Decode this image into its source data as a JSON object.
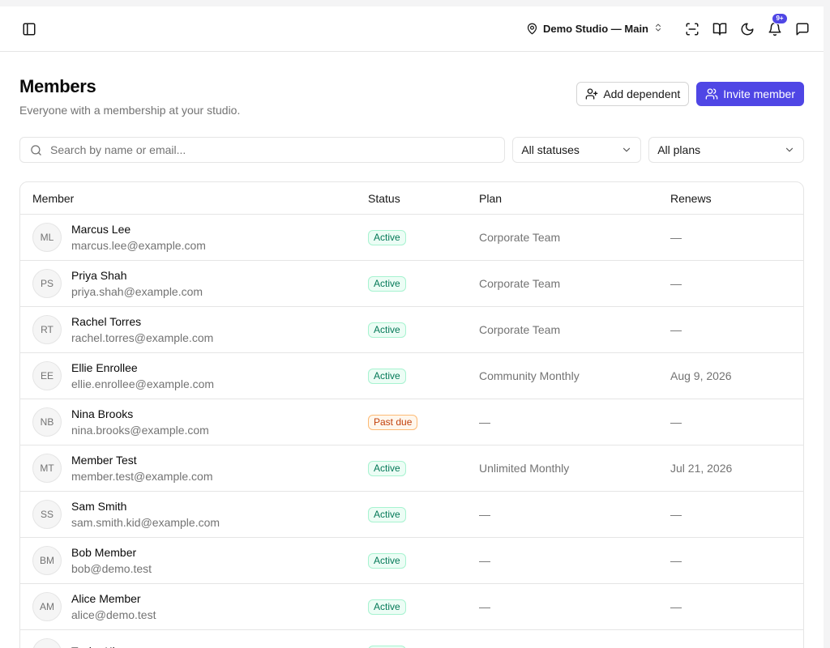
{
  "topbar": {
    "sidebar_toggle_icon": "panel-left-icon",
    "studio_name": "Demo Studio — Main",
    "notifications_count": "9+"
  },
  "page": {
    "title": "Members",
    "subtitle": "Everyone with a membership at your studio."
  },
  "actions": {
    "add_dependent": "Add dependent",
    "invite_member": "Invite member"
  },
  "filters": {
    "search_placeholder": "Search by name or email...",
    "status_value": "All statuses",
    "plan_value": "All plans"
  },
  "table": {
    "headers": {
      "member": "Member",
      "status": "Status",
      "plan": "Plan",
      "renews": "Renews"
    },
    "rows": [
      {
        "initials": "ML",
        "name": "Marcus Lee",
        "email": "marcus.lee@example.com",
        "status": "Active",
        "status_type": "active",
        "plan": "Corporate Team",
        "renews": "—"
      },
      {
        "initials": "PS",
        "name": "Priya Shah",
        "email": "priya.shah@example.com",
        "status": "Active",
        "status_type": "active",
        "plan": "Corporate Team",
        "renews": "—"
      },
      {
        "initials": "RT",
        "name": "Rachel Torres",
        "email": "rachel.torres@example.com",
        "status": "Active",
        "status_type": "active",
        "plan": "Corporate Team",
        "renews": "—"
      },
      {
        "initials": "EE",
        "name": "Ellie Enrollee",
        "email": "ellie.enrollee@example.com",
        "status": "Active",
        "status_type": "active",
        "plan": "Community Monthly",
        "renews": "Aug 9, 2026"
      },
      {
        "initials": "NB",
        "name": "Nina Brooks",
        "email": "nina.brooks@example.com",
        "status": "Past due",
        "status_type": "pastdue",
        "plan": "—",
        "renews": "—"
      },
      {
        "initials": "MT",
        "name": "Member Test",
        "email": "member.test@example.com",
        "status": "Active",
        "status_type": "active",
        "plan": "Unlimited Monthly",
        "renews": "Jul 21, 2026"
      },
      {
        "initials": "SS",
        "name": "Sam Smith",
        "email": "sam.smith.kid@example.com",
        "status": "Active",
        "status_type": "active",
        "plan": "—",
        "renews": "—"
      },
      {
        "initials": "BM",
        "name": "Bob Member",
        "email": "bob@demo.test",
        "status": "Active",
        "status_type": "active",
        "plan": "—",
        "renews": "—"
      },
      {
        "initials": "AM",
        "name": "Alice Member",
        "email": "alice@demo.test",
        "status": "Active",
        "status_type": "active",
        "plan": "—",
        "renews": "—"
      },
      {
        "initials": "TK",
        "name": "Taylor Kim",
        "email": "",
        "status": "Active",
        "status_type": "active",
        "plan": "",
        "renews": ""
      }
    ]
  },
  "colors": {
    "accent": "#4f46e5",
    "active_text": "#047857",
    "active_bg": "#ecfdf5",
    "pastdue_text": "#c2410c",
    "pastdue_bg": "#fff7ed"
  }
}
